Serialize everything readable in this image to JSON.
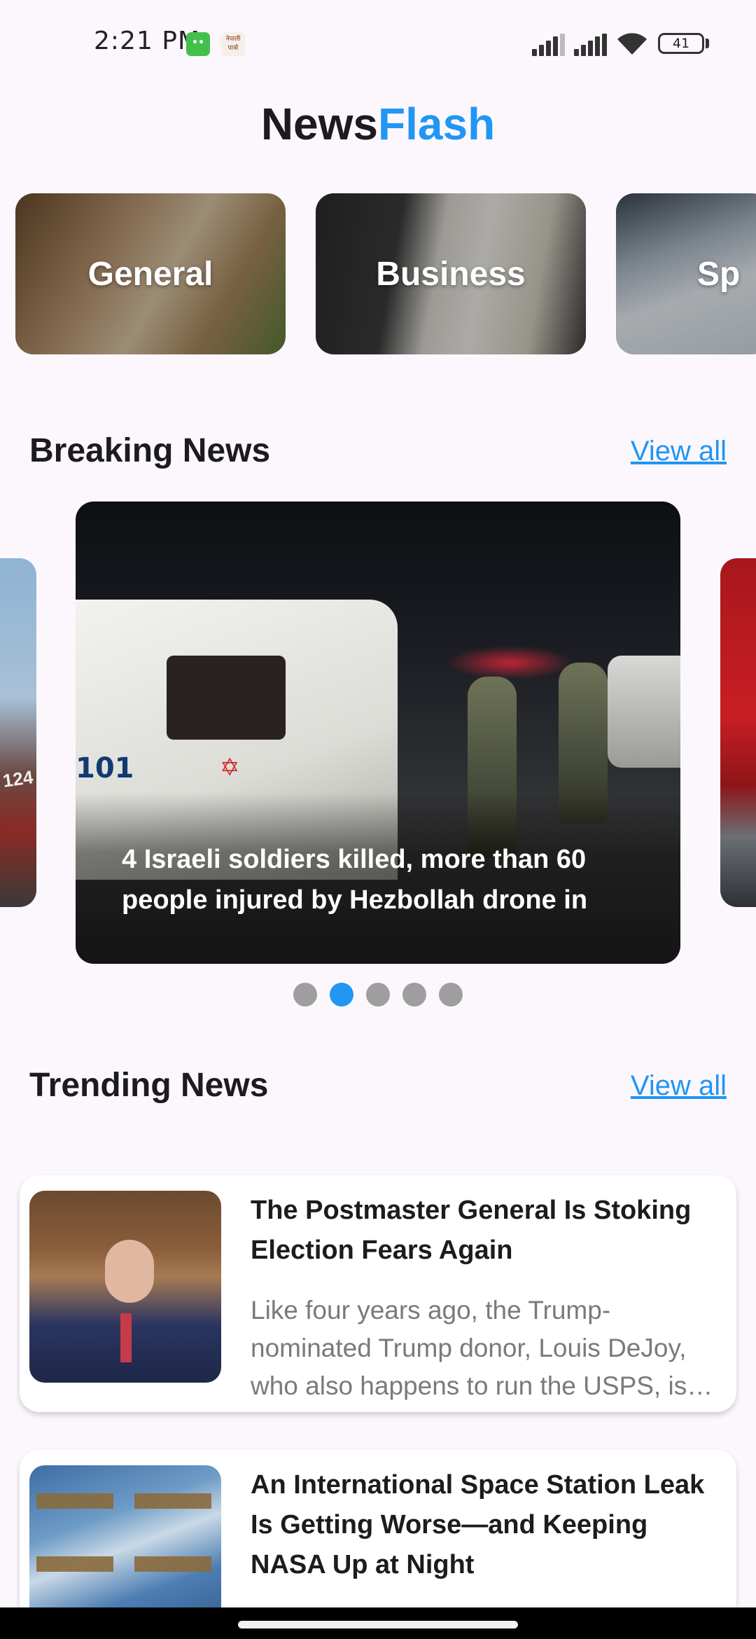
{
  "status_bar": {
    "time": "2:21 PM",
    "notification_icon_2_text": "नेपाली\nपात्रो",
    "battery": "41"
  },
  "app": {
    "title_part1": "News",
    "title_part2": "Flash",
    "accent_color": "#2196f3"
  },
  "categories": [
    {
      "label": "General"
    },
    {
      "label": "Business"
    },
    {
      "label": "Sp"
    }
  ],
  "breaking": {
    "heading": "Breaking News",
    "view_all": "View all",
    "caption": "4 Israeli soldiers killed, more than 60 people injured by Hezbollah drone in",
    "carousel_pages": 5,
    "active_page": 2,
    "left_card_text": "124",
    "image_plate_text": "101"
  },
  "trending": {
    "heading": "Trending News",
    "view_all": "View all",
    "items": [
      {
        "title": "The Postmaster General Is Stoking Election Fears Again",
        "description": "Like four years ago, the Trump-nominated Trump donor, Louis DeJoy, who also happens to run the USPS, is…"
      },
      {
        "title": "An International Space Station Leak Is Getting Worse—and Keeping NASA Up at Night",
        "description": ""
      }
    ]
  }
}
